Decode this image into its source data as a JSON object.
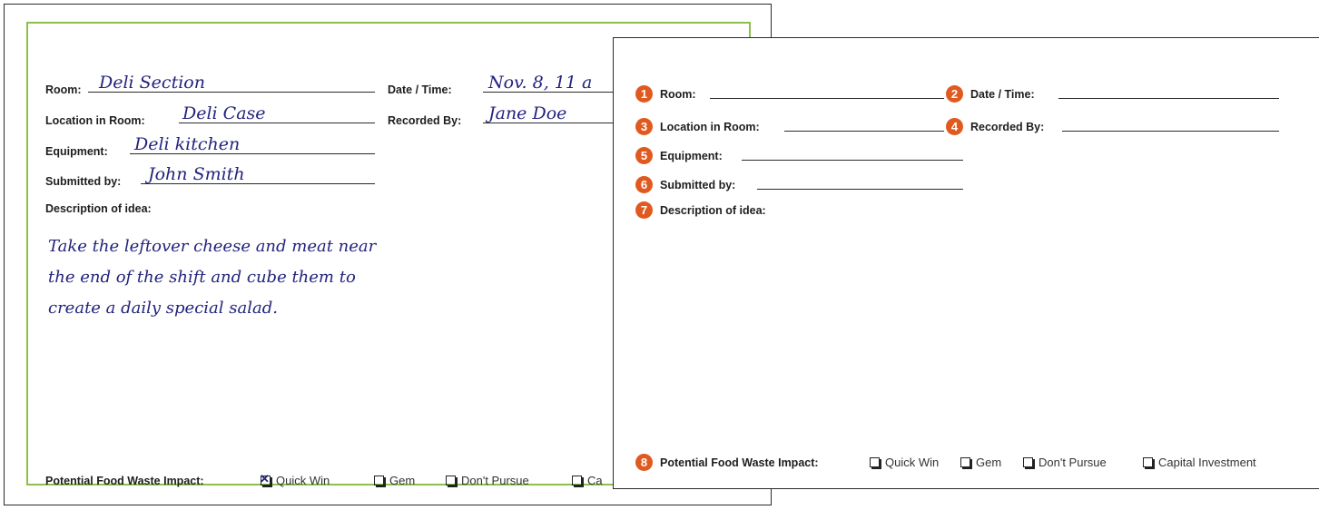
{
  "labels": {
    "room": "Room:",
    "date_time": "Date / Time:",
    "location": "Location in Room:",
    "recorded_by": "Recorded By:",
    "equipment": "Equipment:",
    "submitted_by": "Submitted by:",
    "description": "Description of idea:",
    "impact": "Potential Food Waste Impact:"
  },
  "filled_form": {
    "room": "Deli Section",
    "date_time": "Nov. 8, 11 a",
    "location": "Deli Case",
    "recorded_by": "Jane Doe",
    "equipment": "Deli kitchen",
    "submitted_by": "John Smith",
    "description_lines": [
      "Take the leftover cheese and meat near",
      "the end of the shift and cube them to",
      "create a daily special salad."
    ],
    "options": [
      {
        "label": "Quick Win",
        "checked": true
      },
      {
        "label": "Gem",
        "checked": false
      },
      {
        "label": "Don't Pursue",
        "checked": false
      },
      {
        "label": "Ca",
        "checked": false
      }
    ]
  },
  "blank_form": {
    "badges": [
      "1",
      "2",
      "3",
      "4",
      "5",
      "6",
      "7",
      "8"
    ],
    "options": [
      {
        "label": "Quick Win",
        "checked": false
      },
      {
        "label": "Gem",
        "checked": false
      },
      {
        "label": "Don't Pursue",
        "checked": false
      },
      {
        "label": "Capital Investment",
        "checked": false
      }
    ]
  },
  "colors": {
    "badge": "#e05a1f",
    "handwriting": "#23237e",
    "frame": "#8cc04b"
  }
}
